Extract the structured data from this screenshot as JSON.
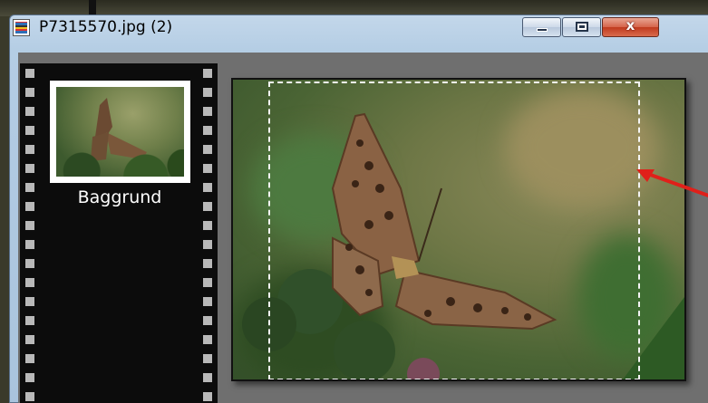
{
  "window": {
    "title": "P7315570.jpg (2)",
    "buttons": {
      "minimize": "",
      "maximize": "",
      "close": "x"
    }
  },
  "filmstrip": {
    "items": [
      {
        "label": "Baggrund",
        "selected": true
      }
    ]
  },
  "image_view": {
    "subject": "butterfly-photo",
    "has_selection": true
  },
  "annotation": {
    "arrow_color": "#e0201a"
  },
  "colors": {
    "title_bar": "#b4cde4",
    "close_button": "#c9472b",
    "filmstrip_bg": "#0c0c0c",
    "workspace_bg": "#6f6f6f"
  }
}
